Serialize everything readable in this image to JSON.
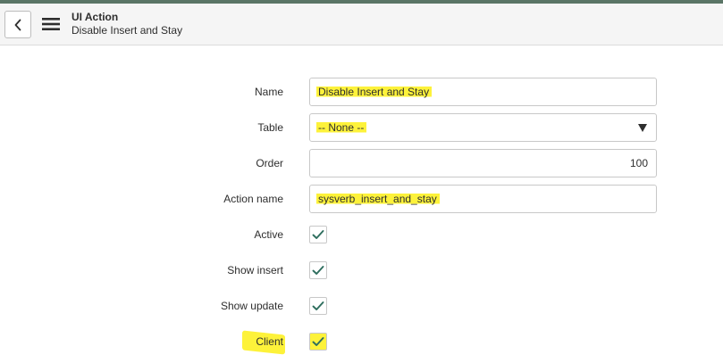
{
  "header": {
    "title": "UI Action",
    "subtitle": "Disable Insert and Stay"
  },
  "form": {
    "name": {
      "label": "Name",
      "value": "Disable Insert and Stay"
    },
    "table": {
      "label": "Table",
      "value": "-- None --"
    },
    "order": {
      "label": "Order",
      "value": "100"
    },
    "action_name": {
      "label": "Action name",
      "value": "sysverb_insert_and_stay"
    },
    "active": {
      "label": "Active",
      "checked": true
    },
    "show_insert": {
      "label": "Show insert",
      "checked": true
    },
    "show_update": {
      "label": "Show update",
      "checked": true
    },
    "client": {
      "label": "Client",
      "checked": true
    }
  },
  "icons": {
    "back": "chevron-left-icon",
    "menu": "hamburger-menu-icon",
    "check": "checkmark-icon",
    "dropdown": "triangle-down-icon"
  },
  "colors": {
    "accent_bar": "#5a7566",
    "check": "#2e6e5e",
    "highlight": "#fdf23a"
  }
}
